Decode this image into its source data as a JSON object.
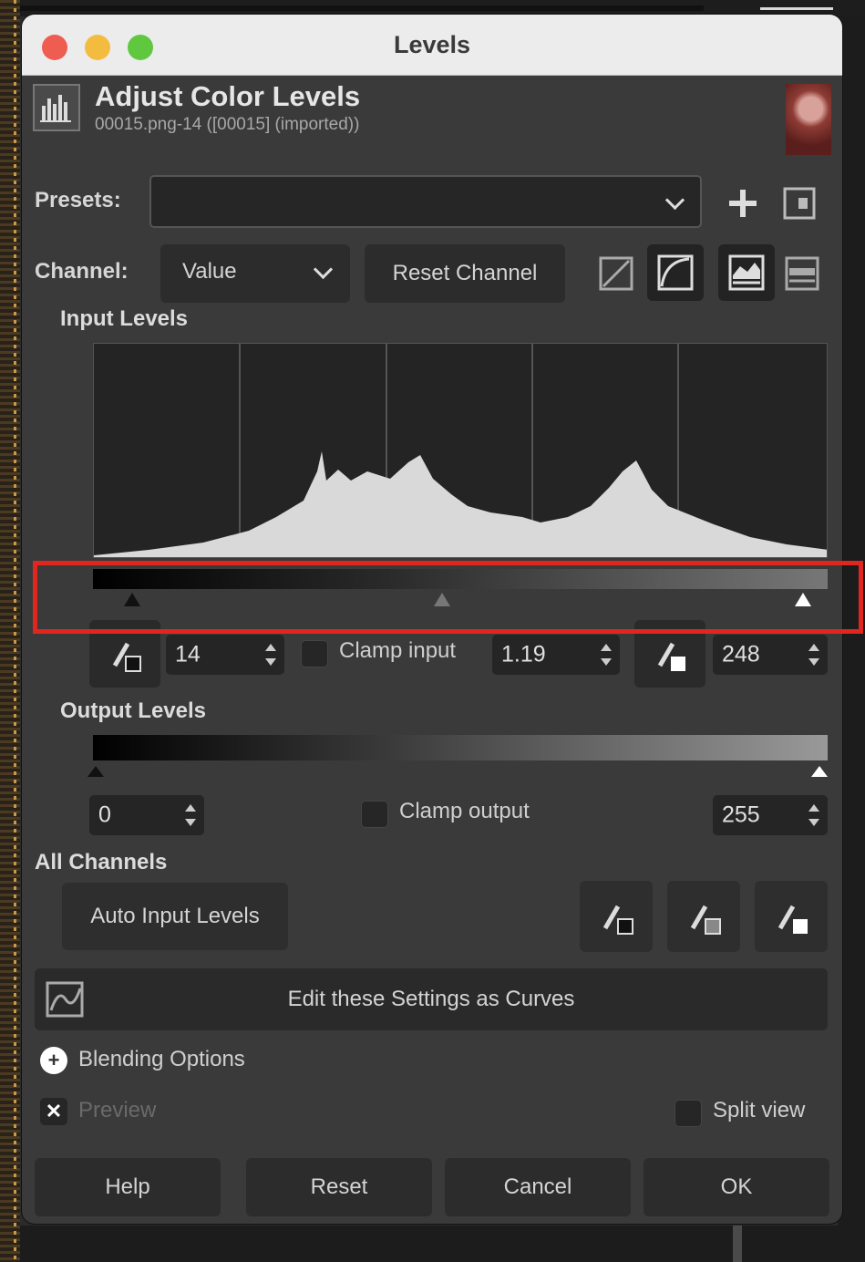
{
  "window": {
    "title": "Levels"
  },
  "header": {
    "title": "Adjust Color Levels",
    "subtitle": "00015.png-14 ([00015] (imported))"
  },
  "presets": {
    "label": "Presets:",
    "value": ""
  },
  "channel": {
    "label": "Channel:",
    "value": "Value",
    "reset_label": "Reset Channel"
  },
  "input_levels": {
    "label": "Input Levels",
    "black_point": "14",
    "gamma": "1.19",
    "white_point": "248",
    "clamp_label": "Clamp input",
    "clamp_checked": false
  },
  "output_levels": {
    "label": "Output Levels",
    "low": "0",
    "high": "255",
    "clamp_label": "Clamp output",
    "clamp_checked": false
  },
  "all_channels": {
    "label": "All Channels",
    "auto_label": "Auto Input Levels"
  },
  "curves_button": "Edit these Settings as Curves",
  "blending_label": "Blending Options",
  "preview": {
    "label": "Preview",
    "checked": true
  },
  "split_view": {
    "label": "Split view",
    "checked": false
  },
  "footer": {
    "help": "Help",
    "reset": "Reset",
    "cancel": "Cancel",
    "ok": "OK"
  },
  "colors": {
    "highlight": "#e0261f",
    "window_bg": "#3a3a3a",
    "histogram_fill": "#d9d9d9"
  }
}
